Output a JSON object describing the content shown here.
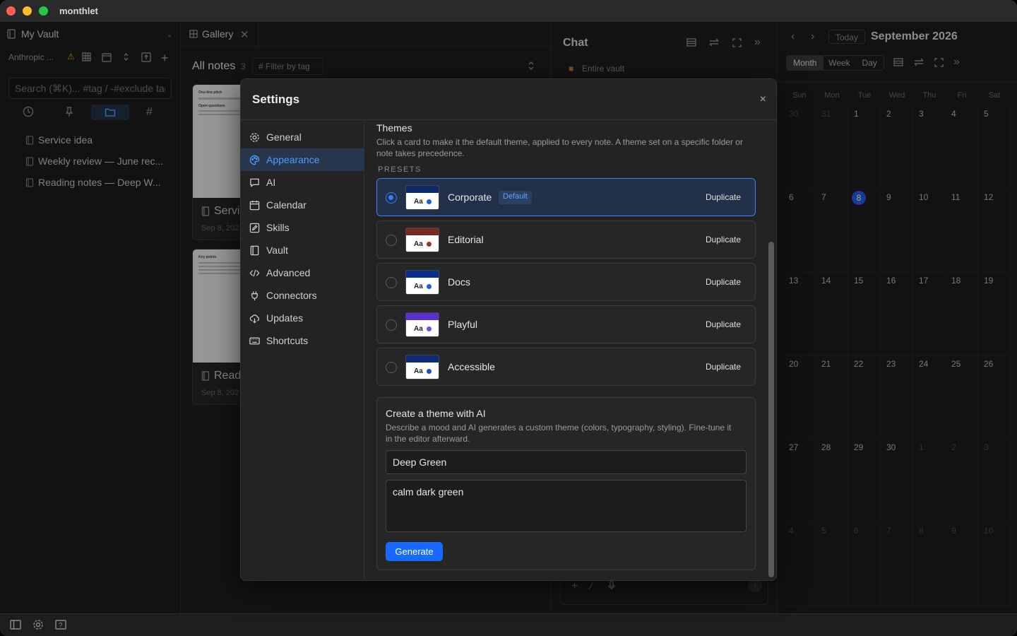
{
  "app": {
    "title": "monthlet"
  },
  "colors": {
    "accent": "#1769ff",
    "selected_border": "#3b82f6",
    "close": "#ff5f57",
    "minimize": "#febc2e",
    "maximize": "#28c840"
  },
  "sidebar": {
    "vault_name": "My Vault",
    "account": "Anthropic ...",
    "search_placeholder": "Search (⌘K)... #tag / -#exclude tag",
    "notes": [
      {
        "title": "Service idea"
      },
      {
        "title": "Weekly review — June rec..."
      },
      {
        "title": "Reading notes — Deep W..."
      }
    ]
  },
  "gallery": {
    "tab_label": "Gallery",
    "heading": "All notes",
    "count": "3",
    "filter_label": "Filter by tag",
    "cards": [
      {
        "title": "Servi",
        "date": "Sep 8, 202",
        "thumb_heading": "One-line pitch",
        "thumb_section": "Open questions"
      },
      {
        "title": "Read",
        "date": "Sep 8, 202",
        "thumb_heading": "Key points",
        "thumb_section": ""
      }
    ]
  },
  "chat": {
    "title": "Chat",
    "scope": "Entire vault"
  },
  "calendar": {
    "today_label": "Today",
    "month_label": "September 2026",
    "views": [
      "Month",
      "Week",
      "Day"
    ],
    "active_view": "Month",
    "weekdays": [
      "Sun",
      "Mon",
      "Tue",
      "Wed",
      "Thu",
      "Fri",
      "Sat"
    ],
    "weeks": [
      [
        "30",
        "31",
        "1",
        "2",
        "3",
        "4",
        "5"
      ],
      [
        "6",
        "7",
        "8",
        "9",
        "10",
        "11",
        "12"
      ],
      [
        "13",
        "14",
        "15",
        "16",
        "17",
        "18",
        "19"
      ],
      [
        "20",
        "21",
        "22",
        "23",
        "24",
        "25",
        "26"
      ],
      [
        "27",
        "28",
        "29",
        "30",
        "1",
        "2",
        "3"
      ],
      [
        "4",
        "5",
        "6",
        "7",
        "8",
        "9",
        "10"
      ]
    ],
    "today": "8"
  },
  "settings": {
    "title": "Settings",
    "close_label": "×",
    "nav": [
      {
        "label": "General",
        "icon": "gear-icon"
      },
      {
        "label": "Appearance",
        "icon": "palette-icon"
      },
      {
        "label": "AI",
        "icon": "chat-icon"
      },
      {
        "label": "Calendar",
        "icon": "calendar-icon"
      },
      {
        "label": "Skills",
        "icon": "edit-box-icon"
      },
      {
        "label": "Vault",
        "icon": "book-icon"
      },
      {
        "label": "Advanced",
        "icon": "code-icon"
      },
      {
        "label": "Connectors",
        "icon": "plug-icon"
      },
      {
        "label": "Updates",
        "icon": "cloud-download-icon"
      },
      {
        "label": "Shortcuts",
        "icon": "keyboard-icon"
      }
    ],
    "active_nav": "Appearance",
    "themes_heading": "Themes",
    "themes_desc": "Click a card to make it the default theme, applied to every note. A theme set on a specific folder or note takes precedence.",
    "presets_label": "PRESETS",
    "duplicate_label": "Duplicate",
    "default_badge": "Default",
    "themes": [
      {
        "name": "Corporate",
        "band": "#0b2a6b",
        "dot": "#1a5fe0",
        "selected": true
      },
      {
        "name": "Editorial",
        "band": "#7a2a22",
        "dot": "#9b3328",
        "selected": false
      },
      {
        "name": "Docs",
        "band": "#0a2f8a",
        "dot": "#1a5fe0",
        "selected": false
      },
      {
        "name": "Playful",
        "band": "#5b2fcf",
        "dot": "#7b47e6",
        "selected": false
      },
      {
        "name": "Accessible",
        "band": "#0d2a7a",
        "dot": "#1a4fc4",
        "selected": false
      }
    ],
    "ai": {
      "title": "Create a theme with AI",
      "desc": "Describe a mood and AI generates a custom theme (colors, typography, styling). Fine-tune it in the editor afterward.",
      "name_value": "Deep Green",
      "prompt_value": "calm dark green",
      "generate_label": "Generate"
    }
  }
}
